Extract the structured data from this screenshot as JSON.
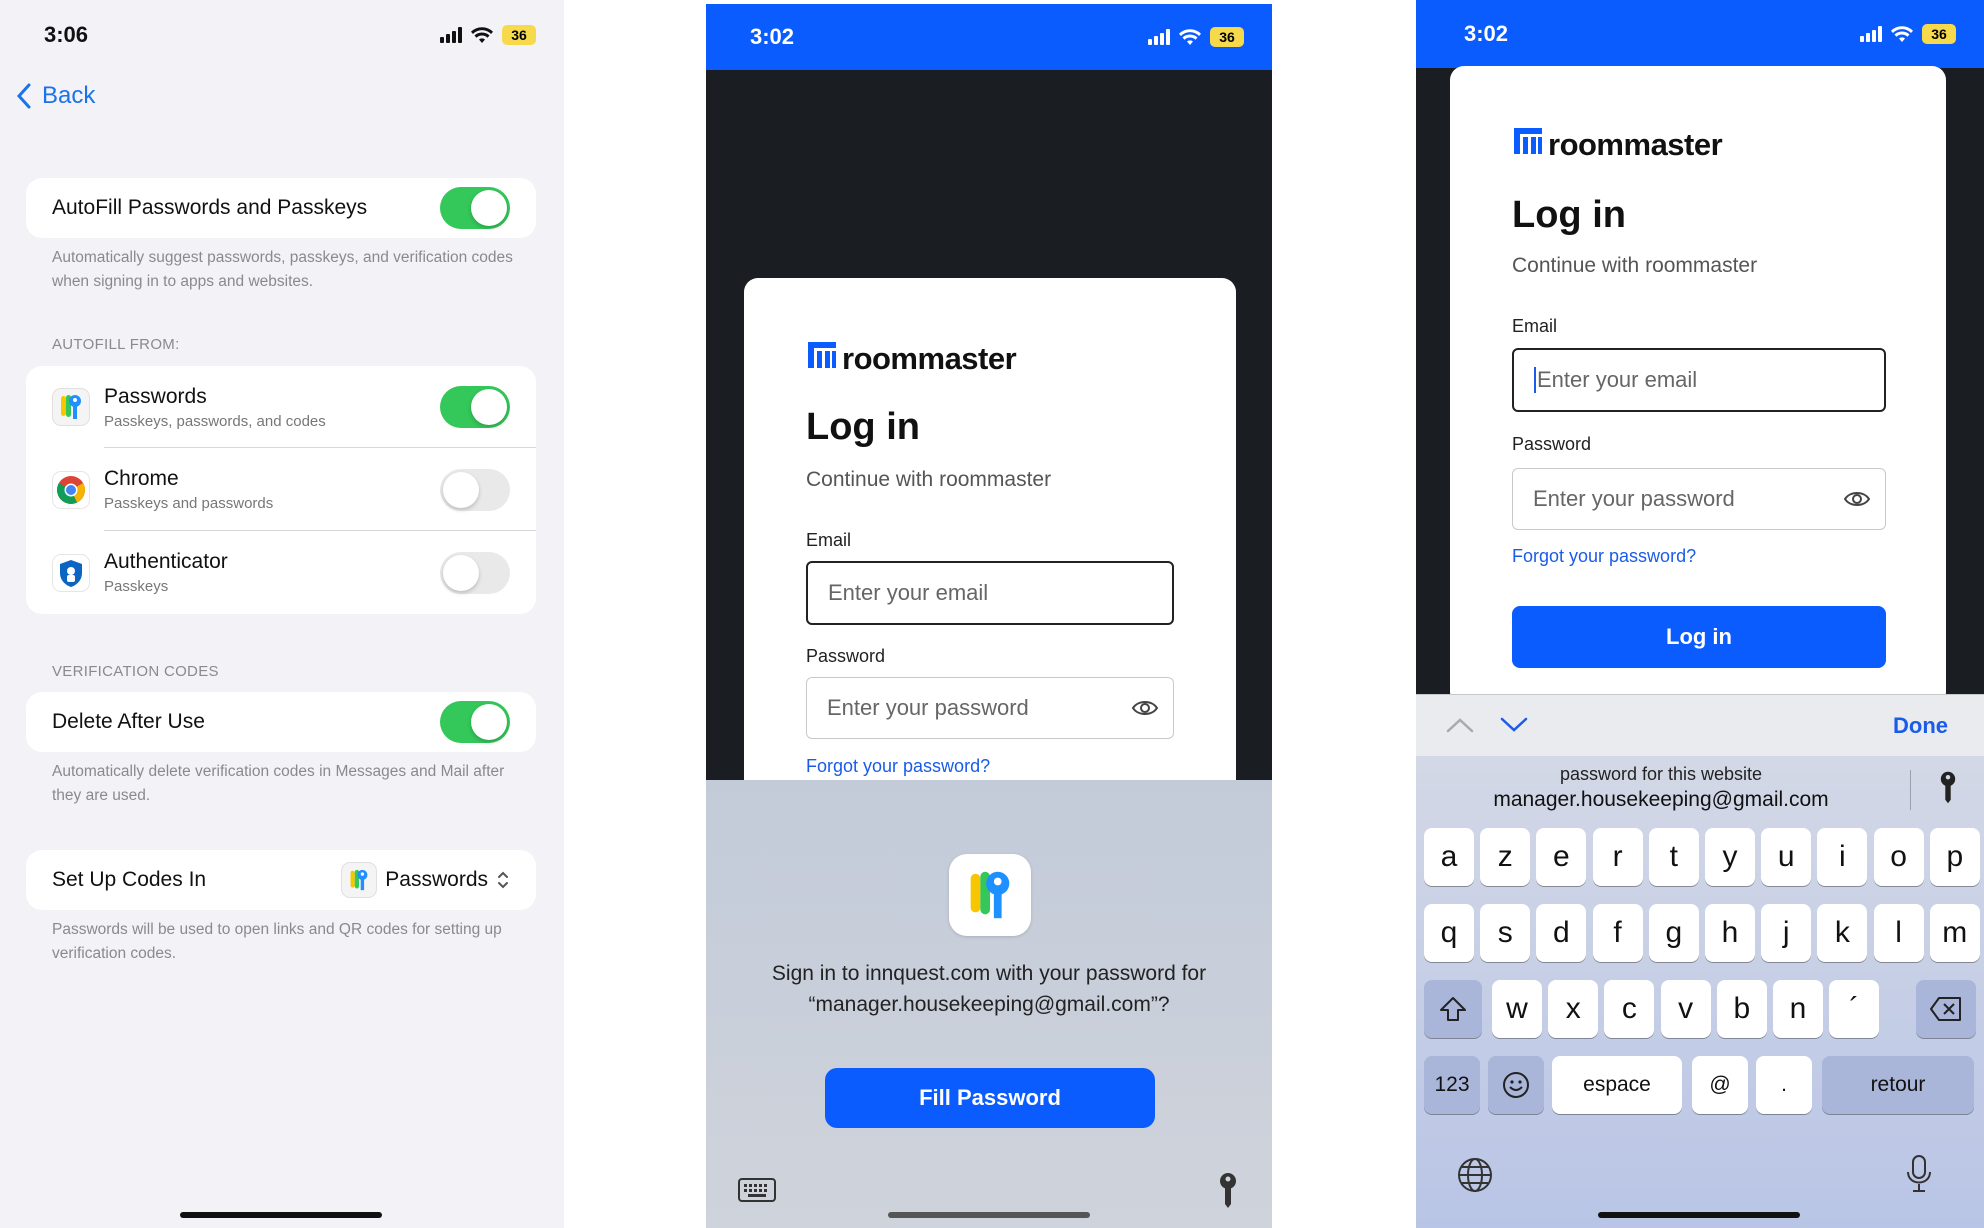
{
  "colors": {
    "accent_blue": "#0b5cff",
    "toggle_on": "#34c759",
    "status_blue": "#0b5cff"
  },
  "panel1": {
    "time": "3:06",
    "battery": "36",
    "back_label": "Back",
    "autofill": {
      "title": "AutoFill Passwords and Passkeys",
      "on": true,
      "footer": "Automatically suggest passwords, passkeys, and verification codes when signing in to apps and websites."
    },
    "autofill_from_header": "AUTOFILL FROM:",
    "sources": [
      {
        "title": "Passwords",
        "subtitle": "Passkeys, passwords, and codes",
        "icon": "passwords-app-icon",
        "on": true
      },
      {
        "title": "Chrome",
        "subtitle": "Passkeys and passwords",
        "icon": "chrome-app-icon",
        "on": false
      },
      {
        "title": "Authenticator",
        "subtitle": "Passkeys",
        "icon": "authenticator-app-icon",
        "on": false
      }
    ],
    "verification_header": "VERIFICATION CODES",
    "delete_after_use": {
      "title": "Delete After Use",
      "on": true,
      "footer": "Automatically delete verification codes in Messages and Mail after they are used."
    },
    "setup_codes": {
      "title": "Set Up Codes In",
      "value": "Passwords",
      "footer": "Passwords will be used to open links and QR codes for setting up verification codes."
    }
  },
  "panel2": {
    "time": "3:02",
    "battery": "36",
    "brand": "roommaster",
    "heading": "Log in",
    "subheading": "Continue with roommaster",
    "email_label": "Email",
    "email_placeholder": "Enter your email",
    "password_label": "Password",
    "password_placeholder": "Enter your password",
    "forgot": "Forgot your password?",
    "prompt": "Sign in to innquest.com with your password for “manager.housekeeping@gmail.com”?",
    "fill_button": "Fill Password"
  },
  "panel3": {
    "time": "3:02",
    "battery": "36",
    "brand": "roommaster",
    "heading": "Log in",
    "subheading": "Continue with roommaster",
    "email_label": "Email",
    "email_placeholder": "Enter your email",
    "password_label": "Password",
    "password_placeholder": "Enter your password",
    "forgot": "Forgot your password?",
    "login_button": "Log in",
    "done": "Done",
    "suggestion_line1": "password for this website",
    "suggestion_line2": "manager.housekeeping@gmail.com",
    "keyboard": {
      "row1": [
        "a",
        "z",
        "e",
        "r",
        "t",
        "y",
        "u",
        "i",
        "o",
        "p"
      ],
      "row2": [
        "q",
        "s",
        "d",
        "f",
        "g",
        "h",
        "j",
        "k",
        "l",
        "m"
      ],
      "row3": [
        "w",
        "x",
        "c",
        "v",
        "b",
        "n",
        "´"
      ],
      "numbers": "123",
      "space": "espace",
      "at": "@",
      "dot": ".",
      "return": "retour"
    }
  }
}
